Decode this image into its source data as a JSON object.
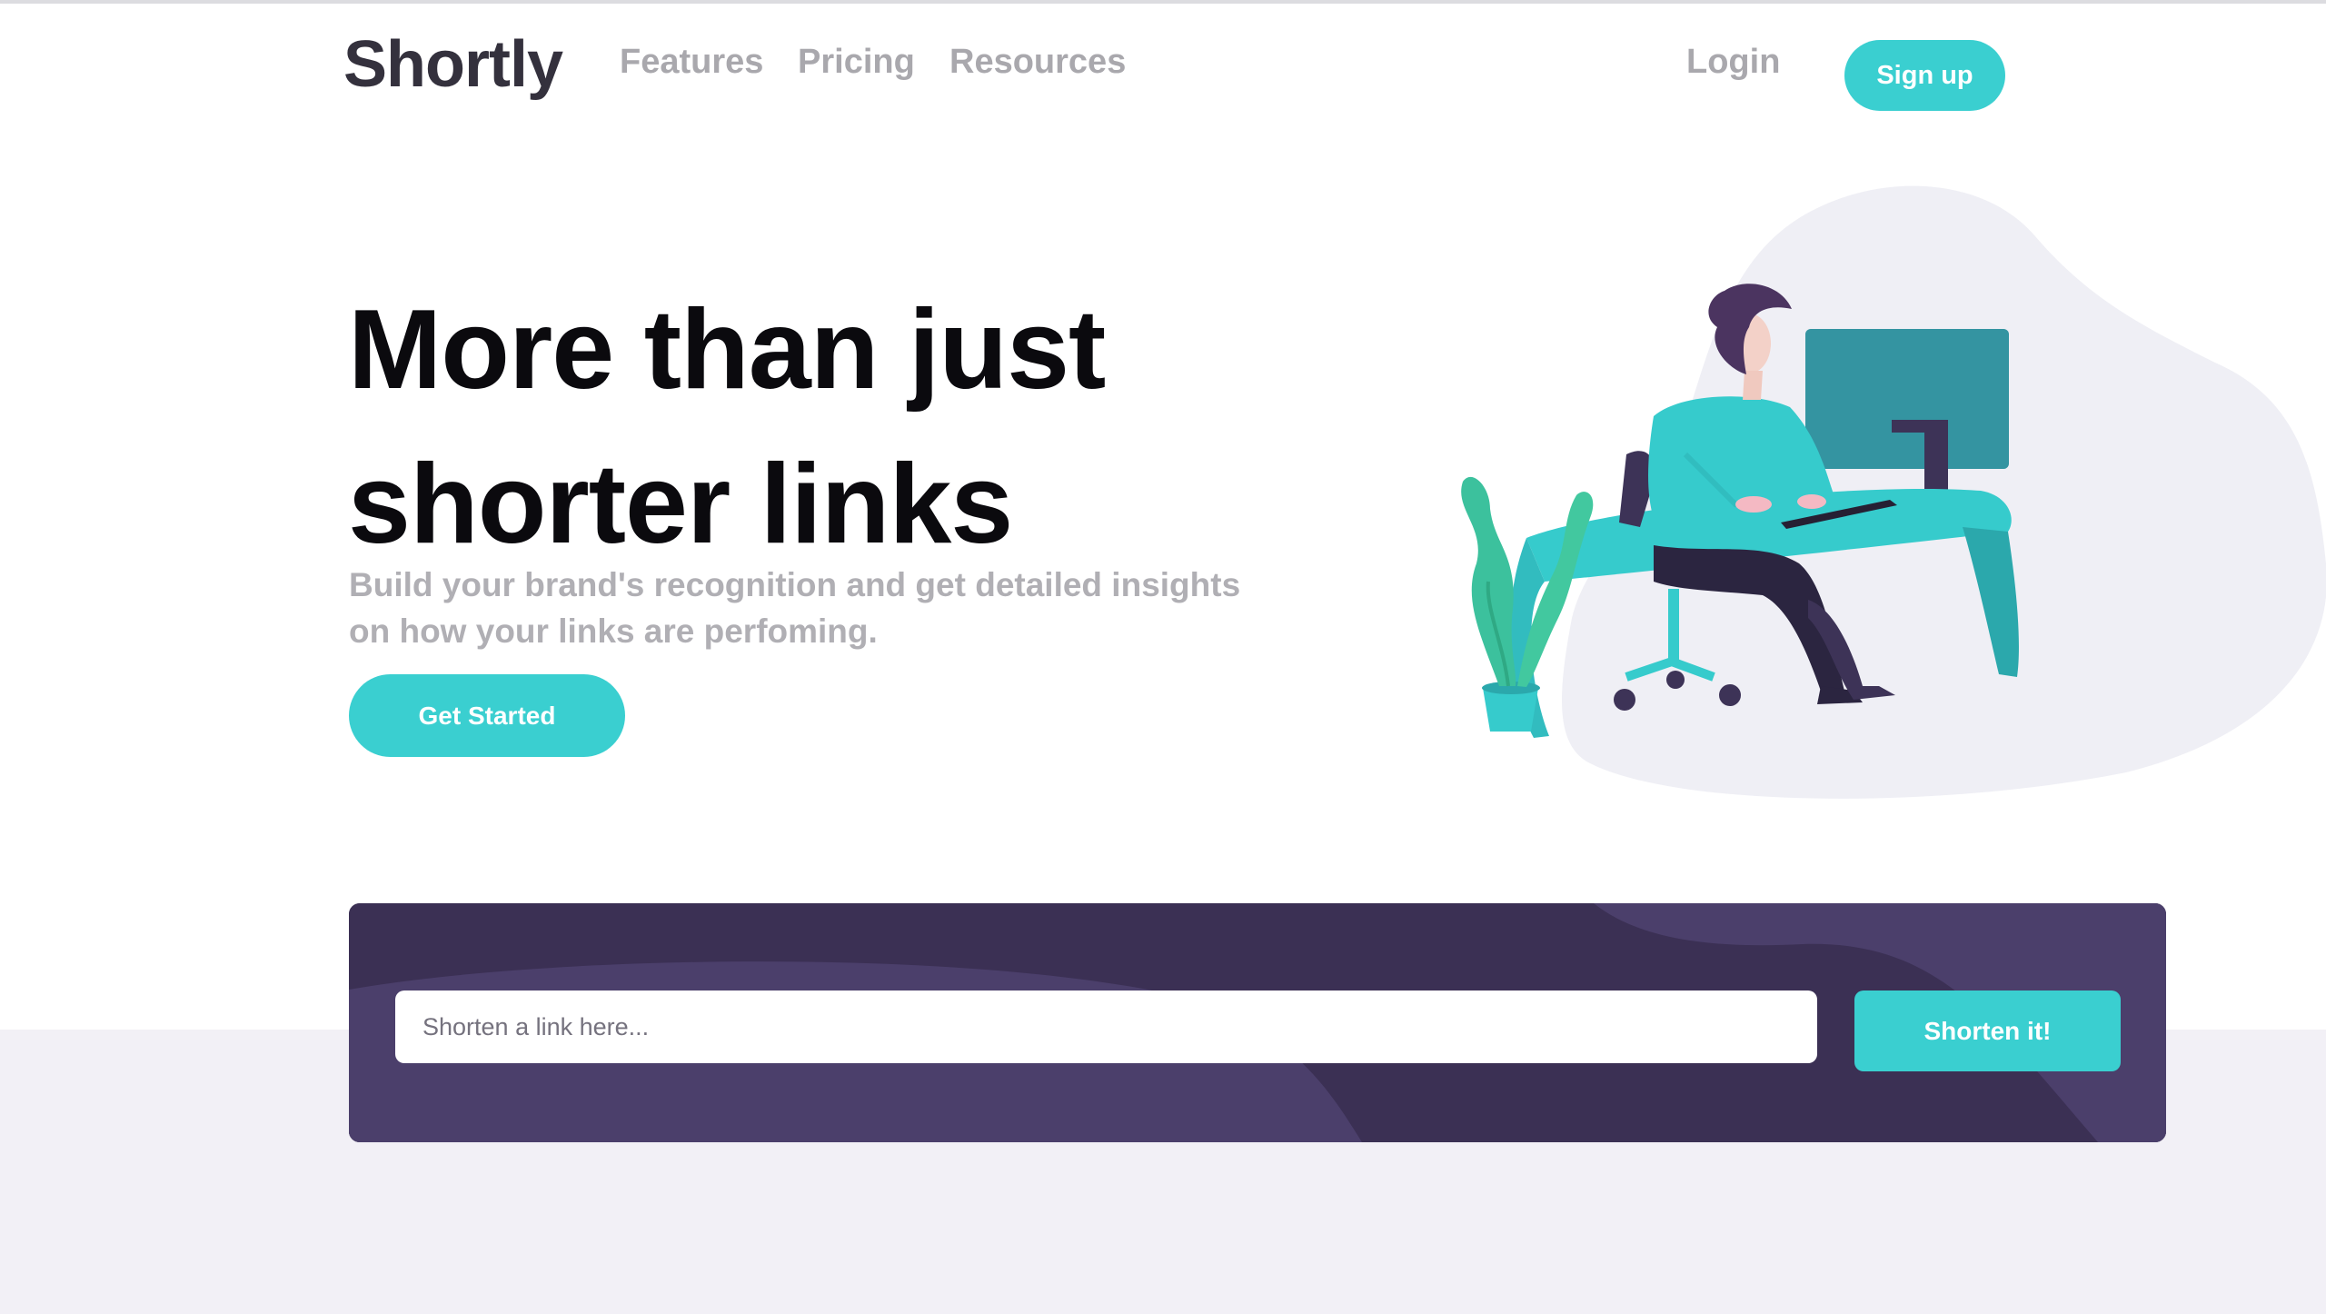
{
  "nav": {
    "logo": "Shortly",
    "links": [
      "Features",
      "Pricing",
      "Resources"
    ],
    "login": "Login",
    "signup": "Sign up"
  },
  "hero": {
    "title_lines": [
      "More than just",
      "shorter links"
    ],
    "subtitle_lines": [
      "Build your brand's recognition and get detailed insights",
      "on how your links are perfoming."
    ],
    "cta": "Get Started"
  },
  "shorten": {
    "placeholder": "Shorten a link here...",
    "button": "Shorten it!"
  },
  "colors": {
    "accent": "#3acfd0",
    "dark_violet": "#3b3054",
    "logo": "#34313d",
    "nav_text": "#a9a8ad",
    "band": "#f2f0f6"
  },
  "icons": {
    "illustration": "person-working-at-desk-illustration"
  }
}
